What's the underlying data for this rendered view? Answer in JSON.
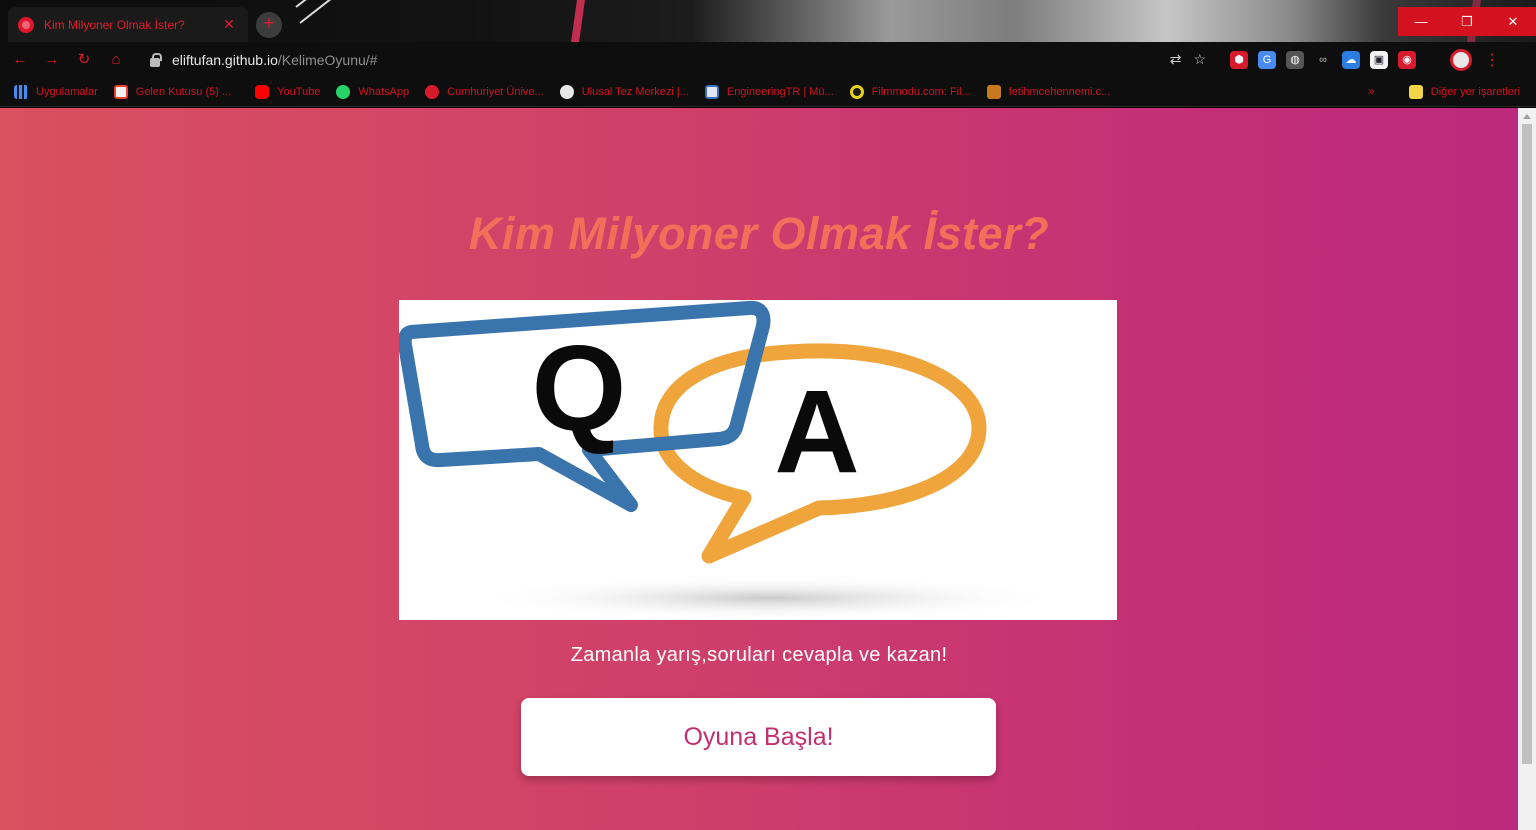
{
  "browser": {
    "tab": {
      "title": "Kim Milyoner Olmak İster?",
      "close_glyph": "✕",
      "favicon": "site-favicon-icon"
    },
    "new_tab_glyph": "+",
    "window_controls": {
      "minimize": "—",
      "restore": "❐",
      "close": "✕"
    },
    "nav": {
      "back": "←",
      "forward": "→",
      "reload": "↻",
      "home": "⌂"
    },
    "address": {
      "host": "eliftufan.github.io",
      "path": "/KelimeOyunu/#"
    },
    "omnibox_icons": {
      "translate": "⇄",
      "star": "☆"
    },
    "extensions": [
      "⬢",
      "G",
      "◍",
      "∞",
      "☁",
      "▣",
      "◉"
    ],
    "menu_glyph": "⋮",
    "bookmarks": [
      {
        "label": "Uygulamalar",
        "icon": "apps-grid-icon",
        "color": "#4a8af4"
      },
      {
        "label": "Gelen Kutusu (5) ...",
        "icon": "gmail-icon",
        "color": "#ea4335"
      },
      {
        "label": "YouTube",
        "icon": "youtube-icon",
        "color": "#ff0000"
      },
      {
        "label": "WhatsApp",
        "icon": "whatsapp-icon",
        "color": "#25d366"
      },
      {
        "label": "Cumhuriyet Ünive...",
        "icon": "university-icon",
        "color": "#d81b2c"
      },
      {
        "label": "Ulusal Tez Merkezi |...",
        "icon": "thesis-icon",
        "color": "#e8e8e8"
      },
      {
        "label": "EngineeringTR | Mü...",
        "icon": "engineering-icon",
        "color": "#3a6fb0"
      },
      {
        "label": "Filmmodu.com: Fil...",
        "icon": "film-icon",
        "color": "#e6d21a"
      },
      {
        "label": "fetihmcehennemi.c...",
        "icon": "site-icon",
        "color": "#c8781e"
      }
    ],
    "bookmarks_chevron": "»",
    "other_bookmarks": "Diğer yer işaretleri"
  },
  "page": {
    "title": "Kim Milyoner Olmak İster?",
    "image": {
      "letter_q": "Q",
      "letter_a": "A"
    },
    "subtitle": "Zamanla yarış,soruları cevapla ve kazan!",
    "start_button": "Oyuna Başla!"
  },
  "colors": {
    "accent_red": "#d81b2c",
    "title_orange": "#f2705a",
    "bubble_blue": "#3a74ad",
    "bubble_orange": "#f0a43c",
    "button_text": "#c32e6f"
  }
}
